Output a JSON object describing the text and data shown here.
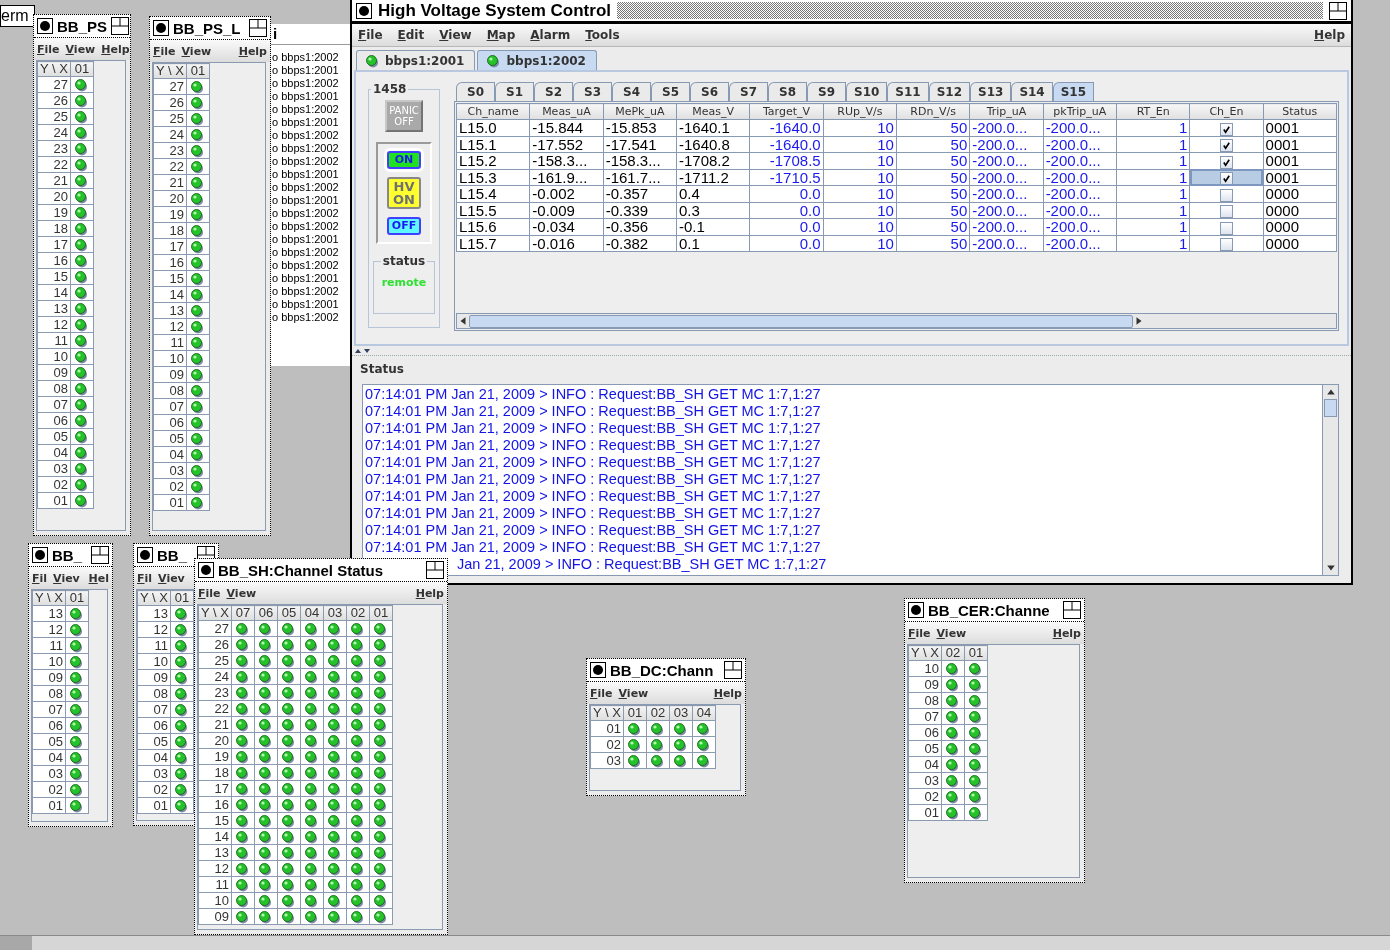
{
  "desktop": {
    "label": "erm"
  },
  "background_list": {
    "title": "i",
    "lines": [
      "o bbps1:2002",
      "o bbps1:2001",
      "o bbps1:2002",
      "o bbps1:2001",
      "o bbps1:2002",
      "o bbps1:2001",
      "o bbps1:2002",
      "o bbps1:2002",
      "o bbps1:2002",
      "o bbps1:2001",
      "o bbps1:2002",
      "o bbps1:2001",
      "o bbps1:2002",
      "o bbps1:2002",
      "o bbps1:2001",
      "o bbps1:2002",
      "o bbps1:2002",
      "o bbps1:2001",
      "o bbps1:2002",
      "o bbps1:2001",
      "o bbps1:2002"
    ]
  },
  "main_window": {
    "title": "High Voltage System Control",
    "menus": [
      "File",
      "Edit",
      "View",
      "Map",
      "Alarm",
      "Tools"
    ],
    "help": "Help",
    "server_tabs": [
      {
        "label": "bbps1:2001",
        "selected": false
      },
      {
        "label": "bbps1:2002",
        "selected": true
      }
    ],
    "crate": {
      "title": "1458",
      "panic_button": {
        "label": "PANIC OFF",
        "disabled": true
      },
      "buttons": [
        {
          "label": "ON",
          "kind": "on",
          "selected": true
        },
        {
          "label": "HV ON",
          "kind": "hv",
          "selected": false
        },
        {
          "label": "OFF",
          "kind": "off",
          "selected": false
        }
      ],
      "status": {
        "title": "status",
        "value": "remote"
      }
    },
    "slot_tabs": [
      {
        "label": "S0",
        "selected": false
      },
      {
        "label": "S1",
        "selected": false
      },
      {
        "label": "S2",
        "selected": false
      },
      {
        "label": "S3",
        "selected": false
      },
      {
        "label": "S4",
        "selected": false
      },
      {
        "label": "S5",
        "selected": false
      },
      {
        "label": "S6",
        "selected": false
      },
      {
        "label": "S7",
        "selected": false
      },
      {
        "label": "S8",
        "selected": false
      },
      {
        "label": "S9",
        "selected": false
      },
      {
        "label": "S10",
        "selected": false
      },
      {
        "label": "S11",
        "selected": false
      },
      {
        "label": "S12",
        "selected": false
      },
      {
        "label": "S13",
        "selected": false
      },
      {
        "label": "S14",
        "selected": false
      },
      {
        "label": "S15",
        "selected": true
      }
    ],
    "table": {
      "columns": [
        {
          "label": "Ch_name",
          "kind": "reading"
        },
        {
          "label": "Meas_uA",
          "kind": "reading"
        },
        {
          "label": "MePk_uA",
          "kind": "reading"
        },
        {
          "label": "Meas_V",
          "kind": "reading"
        },
        {
          "label": "Target_V",
          "kind": "setpoint"
        },
        {
          "label": "RUp_V/s",
          "kind": "setpoint"
        },
        {
          "label": "RDn_V/s",
          "kind": "setpoint"
        },
        {
          "label": "Trip_uA",
          "kind": "limit"
        },
        {
          "label": "pkTrip_uA",
          "kind": "limit"
        },
        {
          "label": "RT_En",
          "kind": "setpoint"
        },
        {
          "label": "Ch_En",
          "kind": "check"
        },
        {
          "label": "Status",
          "kind": "status"
        }
      ],
      "rows": [
        {
          "selected": false,
          "values": [
            "L15.0",
            "-15.844",
            "-15.853",
            "-1640.1",
            "-1640.0",
            "10",
            "50",
            "-200.0...",
            "-200.0...",
            "1",
            true,
            "0001"
          ]
        },
        {
          "selected": false,
          "values": [
            "L15.1",
            "-17.552",
            "-17.541",
            "-1640.8",
            "-1640.0",
            "10",
            "50",
            "-200.0...",
            "-200.0...",
            "1",
            true,
            "0001"
          ]
        },
        {
          "selected": false,
          "values": [
            "L15.2",
            "-158.3...",
            "-158.3...",
            "-1708.2",
            "-1708.5",
            "10",
            "50",
            "-200.0...",
            "-200.0...",
            "1",
            true,
            "0001"
          ]
        },
        {
          "selected": true,
          "values": [
            "L15.3",
            "-161.9...",
            "-161.7...",
            "-1711.2",
            "-1710.5",
            "10",
            "50",
            "-200.0...",
            "-200.0...",
            "1",
            true,
            "0001"
          ]
        },
        {
          "selected": false,
          "values": [
            "L15.4",
            "-0.002",
            "-0.357",
            "0.4",
            "0.0",
            "10",
            "50",
            "-200.0...",
            "-200.0...",
            "1",
            false,
            "0000"
          ]
        },
        {
          "selected": false,
          "values": [
            "L15.5",
            "-0.009",
            "-0.339",
            "0.3",
            "0.0",
            "10",
            "50",
            "-200.0...",
            "-200.0...",
            "1",
            false,
            "0000"
          ]
        },
        {
          "selected": false,
          "values": [
            "L15.6",
            "-0.034",
            "-0.356",
            "-0.1",
            "0.0",
            "10",
            "50",
            "-200.0...",
            "-200.0...",
            "1",
            false,
            "0000"
          ]
        },
        {
          "selected": false,
          "values": [
            "L15.7",
            "-0.016",
            "-0.382",
            "0.1",
            "0.0",
            "10",
            "50",
            "-200.0...",
            "-200.0...",
            "1",
            false,
            "0000"
          ]
        }
      ]
    },
    "log": {
      "title": "Status",
      "lines": [
        "07:14:01 PM Jan 21, 2009 > INFO : Request:BB_SH GET MC 1:7,1:27",
        "07:14:01 PM Jan 21, 2009 > INFO : Request:BB_SH GET MC 1:7,1:27",
        "07:14:01 PM Jan 21, 2009 > INFO : Request:BB_SH GET MC 1:7,1:27",
        "07:14:01 PM Jan 21, 2009 > INFO : Request:BB_SH GET MC 1:7,1:27",
        "07:14:01 PM Jan 21, 2009 > INFO : Request:BB_SH GET MC 1:7,1:27",
        "07:14:01 PM Jan 21, 2009 > INFO : Request:BB_SH GET MC 1:7,1:27",
        "07:14:01 PM Jan 21, 2009 > INFO : Request:BB_SH GET MC 1:7,1:27",
        "07:14:01 PM Jan 21, 2009 > INFO : Request:BB_SH GET MC 1:7,1:27",
        "07:14:01 PM Jan 21, 2009 > INFO : Request:BB_SH GET MC 1:7,1:27",
        "07:14:01 PM Jan 21, 2009 > INFO : Request:BB_SH GET MC 1:7,1:27",
        "Jan 21, 2009 > INFO : Request:BB_SH GET MC 1:7,1:27"
      ]
    }
  },
  "grid_windows": [
    {
      "title": "BB_PS",
      "menus": [
        "File",
        "View"
      ],
      "help": "Help",
      "corner": "Y \\ X",
      "columns": [
        "01"
      ],
      "rows": [
        "27",
        "26",
        "25",
        "24",
        "23",
        "22",
        "21",
        "20",
        "19",
        "18",
        "17",
        "16",
        "15",
        "14",
        "13",
        "12",
        "11",
        "10",
        "09",
        "08",
        "07",
        "06",
        "05",
        "04",
        "03",
        "02",
        "01"
      ]
    },
    {
      "title": "BB_PS_L",
      "menus": [
        "File",
        "View"
      ],
      "help": "Help",
      "corner": "Y \\ X",
      "columns": [
        "01"
      ],
      "rows": [
        "27",
        "26",
        "25",
        "24",
        "23",
        "22",
        "21",
        "20",
        "19",
        "18",
        "17",
        "16",
        "15",
        "14",
        "13",
        "12",
        "11",
        "10",
        "09",
        "08",
        "07",
        "06",
        "05",
        "04",
        "03",
        "02",
        "01"
      ]
    },
    {
      "title": "BB_",
      "menus": [
        "Fil",
        "Viev"
      ],
      "help": "Hel",
      "corner": "Y \\ X",
      "columns": [
        "01"
      ],
      "rows": [
        "13",
        "12",
        "11",
        "10",
        "09",
        "08",
        "07",
        "06",
        "05",
        "04",
        "03",
        "02",
        "01"
      ]
    },
    {
      "title": "BB_",
      "menus": [
        "Fil",
        "Viev"
      ],
      "corner": "Y \\ X",
      "columns": [
        "01"
      ],
      "rows": [
        "13",
        "12",
        "11",
        "10",
        "09",
        "08",
        "07",
        "06",
        "05",
        "04",
        "03",
        "02",
        "01"
      ]
    },
    {
      "title": "BB_SH:Channel Status",
      "menus": [
        "File",
        "View"
      ],
      "help": "Help",
      "corner": "Y \\ X",
      "columns": [
        "07",
        "06",
        "05",
        "04",
        "03",
        "02",
        "01"
      ],
      "rows": [
        "27",
        "26",
        "25",
        "24",
        "23",
        "22",
        "21",
        "20",
        "19",
        "18",
        "17",
        "16",
        "15",
        "14",
        "13",
        "12",
        "11",
        "10",
        "09"
      ]
    },
    {
      "title": "BB_DC:Chann",
      "menus": [
        "File",
        "View"
      ],
      "help": "Help",
      "corner": "Y \\ X",
      "columns": [
        "01",
        "02",
        "03",
        "04"
      ],
      "rows": [
        "01",
        "02",
        "03"
      ]
    },
    {
      "title": "BB_CER:Channe",
      "menus": [
        "File",
        "View"
      ],
      "help": "Help",
      "corner": "Y \\ X",
      "columns": [
        "02",
        "01"
      ],
      "rows": [
        "10",
        "09",
        "08",
        "07",
        "06",
        "05",
        "04",
        "03",
        "02",
        "01"
      ]
    }
  ]
}
